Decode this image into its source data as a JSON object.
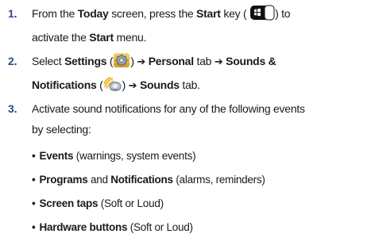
{
  "steps": [
    {
      "number": "1.",
      "s1_a": "From the ",
      "s1_b": "Today",
      "s1_c": " screen, press the ",
      "s1_d": "Start",
      "s1_e": " key (",
      "s1_f": ") to",
      "s1_g": "activate the ",
      "s1_h": "Start",
      "s1_i": " menu.",
      "icon": "windows-start-key-icon"
    },
    {
      "number": "2.",
      "s2_a": "Select ",
      "s2_b": "Settings",
      "s2_c": " (",
      "s2_d": ") ",
      "arrow": "➔",
      "s2_e": "Personal",
      "s2_f": " tab ",
      "s2_g": "Sounds &",
      "s2_h": "Notifications",
      "s2_i": " (",
      "s2_j": ") ",
      "s2_k": "Sounds",
      "s2_l": " tab.",
      "icons": [
        "settings-gear-icon",
        "sounds-notifications-icon"
      ]
    },
    {
      "number": "3.",
      "s3_a": "Activate sound notifications for any of the following events",
      "s3_b": "by selecting:"
    }
  ],
  "bullets": [
    {
      "bold": "Events",
      "rest": " (warnings, system events)"
    },
    {
      "bold": "Programs",
      "mid": " and ",
      "bold2": "Notifications",
      "rest": " (alarms, reminders)"
    },
    {
      "bold": "Screen taps",
      "rest": " (Soft or Loud)"
    },
    {
      "bold": "Hardware buttons",
      "rest": " (Soft or Loud)"
    }
  ],
  "bullet_symbol": "•",
  "colors": {
    "step_number": "#2b4a8a",
    "text": "#1a1a1a"
  }
}
